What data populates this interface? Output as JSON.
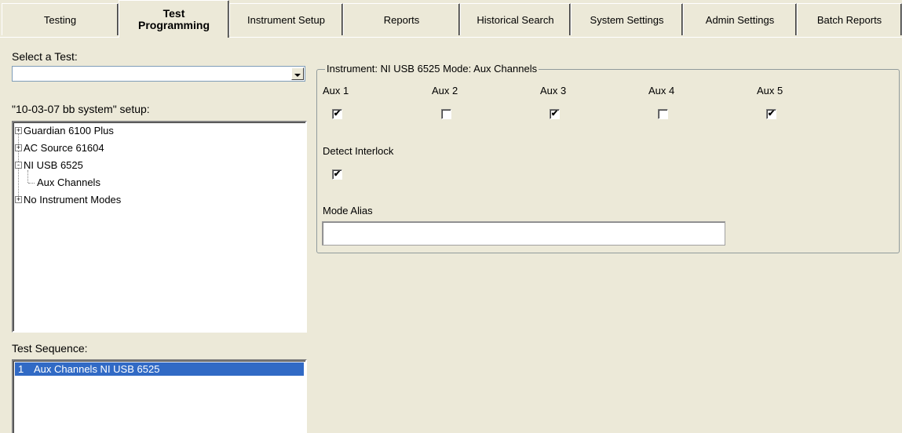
{
  "tabs": [
    {
      "label": "Testing"
    },
    {
      "label": "Test Programming",
      "active": true
    },
    {
      "label": "Instrument Setup"
    },
    {
      "label": "Reports"
    },
    {
      "label": "Historical Search"
    },
    {
      "label": "System Settings"
    },
    {
      "label": "Admin Settings"
    },
    {
      "label": "Batch Reports"
    }
  ],
  "left": {
    "select_test_label": "Select a Test:",
    "select_test_value": "",
    "setup_label": "\"10-03-07 bb system\" setup:",
    "tree": [
      {
        "label": "Guardian 6100 Plus",
        "expander": "+"
      },
      {
        "label": "AC Source 61604",
        "expander": "+"
      },
      {
        "label": "NI USB 6525",
        "expander": "-"
      },
      {
        "label": "Aux Channels",
        "expander": ""
      },
      {
        "label": "No Instrument Modes",
        "expander": "+"
      }
    ],
    "sequence_label": "Test Sequence:",
    "sequence": [
      {
        "num": "1",
        "label": "Aux Channels NI USB 6525",
        "selected": true
      }
    ]
  },
  "group": {
    "title": "Instrument: NI USB 6525  Mode: Aux Channels",
    "channels": [
      {
        "label": "Aux 1",
        "checked": true
      },
      {
        "label": "Aux 2",
        "checked": false
      },
      {
        "label": "Aux 3",
        "checked": true
      },
      {
        "label": "Aux 4",
        "checked": false
      },
      {
        "label": "Aux 5",
        "checked": true
      }
    ],
    "interlock_label": "Detect Interlock",
    "interlock_checked": true,
    "alias_label": "Mode Alias",
    "alias_value": ""
  },
  "colors": {
    "selection": "#316ac5",
    "face": "#ece9d8"
  }
}
